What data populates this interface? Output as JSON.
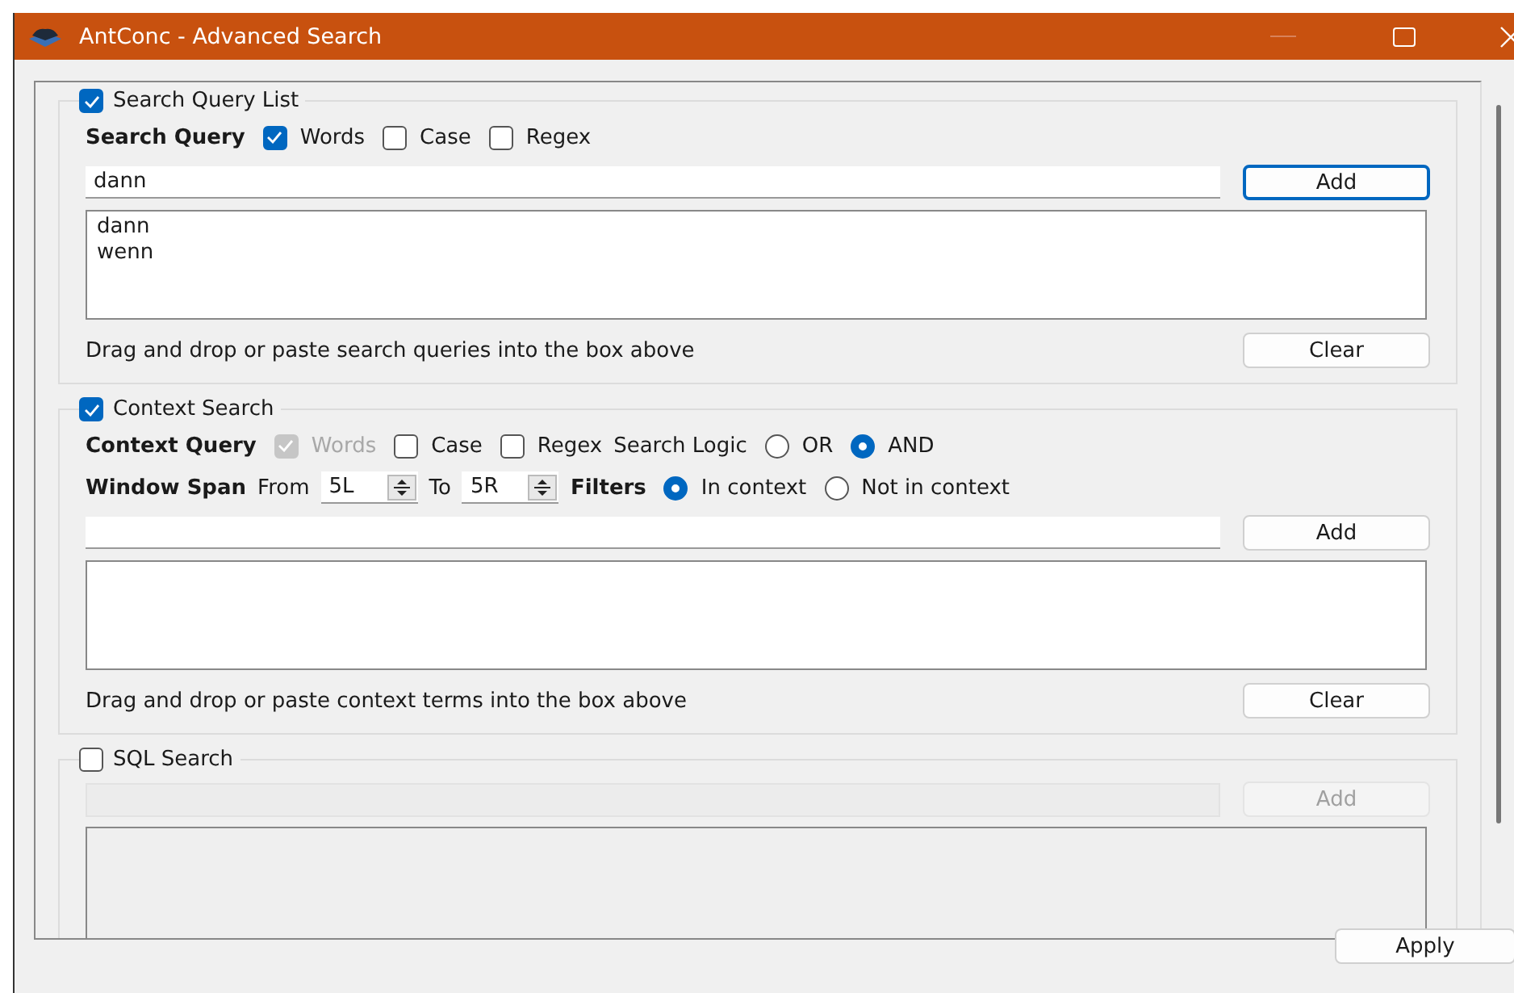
{
  "window": {
    "title": "AntConc - Advanced Search"
  },
  "sections": [
    {
      "kind": "query",
      "title": "Search Query List",
      "checked": true,
      "query_label": "Search Query",
      "options": [
        {
          "label": "Words",
          "checked": true,
          "disabled": false
        },
        {
          "label": "Case",
          "checked": false,
          "disabled": false
        },
        {
          "label": "Regex",
          "checked": false,
          "disabled": false
        }
      ],
      "input_value": "dann",
      "add": "Add",
      "items": [
        "dann",
        "wenn"
      ],
      "hint": "Drag and drop or paste search queries into the box above",
      "clear": "Clear"
    },
    {
      "kind": "context",
      "title": "Context Search",
      "checked": true,
      "query_label": "Context Query",
      "options": [
        {
          "label": "Words",
          "checked": true,
          "disabled": true
        },
        {
          "label": "Case",
          "checked": false,
          "disabled": false
        },
        {
          "label": "Regex",
          "checked": false,
          "disabled": false
        }
      ],
      "logic_label": "Search Logic",
      "logic": [
        {
          "label": "OR",
          "selected": false
        },
        {
          "label": "AND",
          "selected": true
        }
      ],
      "span_label": "Window Span",
      "from_label": "From",
      "from_value": "5L",
      "to_label": "To",
      "to_value": "5R",
      "filters_label": "Filters",
      "filters": [
        {
          "label": "In context",
          "selected": true
        },
        {
          "label": "Not in context",
          "selected": false
        }
      ],
      "add": "Add",
      "hint": "Drag and drop or paste context terms into the box above",
      "clear": "Clear"
    },
    {
      "kind": "sql",
      "title": "SQL Search",
      "checked": false,
      "add": "Add"
    }
  ],
  "apply": "Apply"
}
